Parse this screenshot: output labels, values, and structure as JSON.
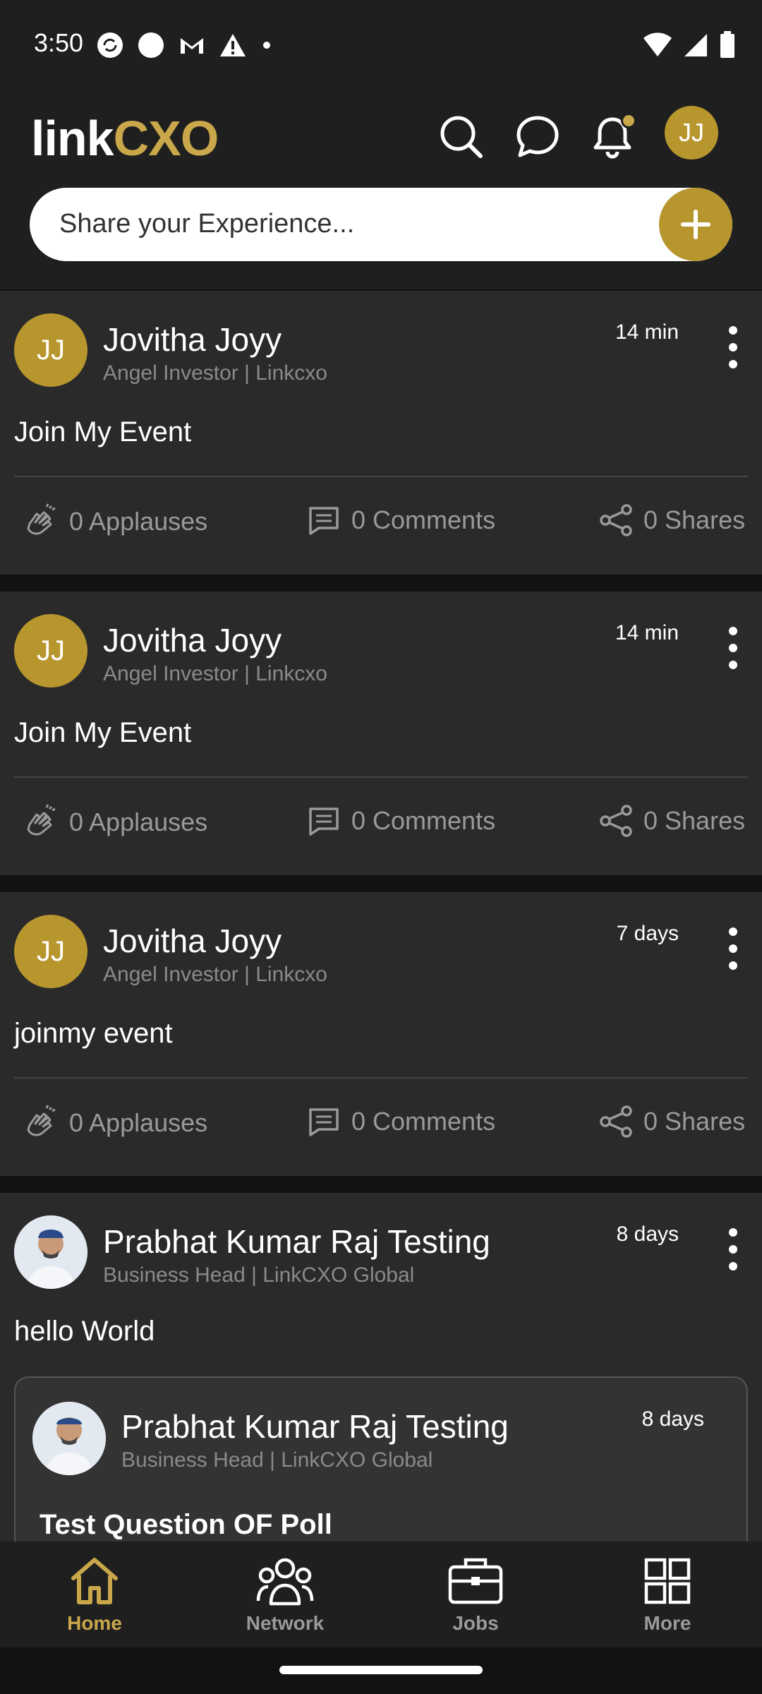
{
  "status_bar": {
    "time": "3:50"
  },
  "header": {
    "logo_link": "link",
    "logo_cxo": "CXO",
    "avatar_initials": "JJ",
    "accent_color": "#c9a74a"
  },
  "share": {
    "placeholder": "Share your Experience..."
  },
  "posts": [
    {
      "initials": "JJ",
      "name": "Jovitha Joyy",
      "subtitle": "Angel Investor | Linkcxo",
      "time": "14 min",
      "text": "Join My Event",
      "applauses": "0 Applauses",
      "comments": "0 Comments",
      "shares": "0 Shares"
    },
    {
      "initials": "JJ",
      "name": "Jovitha Joyy",
      "subtitle": "Angel Investor | Linkcxo",
      "time": "14 min",
      "text": "Join My Event",
      "applauses": "0 Applauses",
      "comments": "0 Comments",
      "shares": "0 Shares"
    },
    {
      "initials": "JJ",
      "name": "Jovitha Joyy",
      "subtitle": "Angel Investor | Linkcxo",
      "time": "7 days",
      "text": "joinmy event",
      "applauses": "0 Applauses",
      "comments": "0 Comments",
      "shares": "0 Shares"
    },
    {
      "name": "Prabhat Kumar Raj Testing",
      "subtitle": "Business Head | LinkCXO Global",
      "time": "8 days",
      "text": "hello World",
      "shared": {
        "name": "Prabhat Kumar Raj Testing",
        "subtitle": "Business Head | LinkCXO Global",
        "time": "8 days",
        "question": "Test Question OF Poll"
      }
    }
  ],
  "bottom_nav": {
    "items": [
      {
        "label": "Home",
        "icon": "home-icon",
        "active": true
      },
      {
        "label": "Network",
        "icon": "network-icon",
        "active": false
      },
      {
        "label": "Jobs",
        "icon": "jobs-icon",
        "active": false
      },
      {
        "label": "More",
        "icon": "more-icon",
        "active": false
      }
    ]
  }
}
